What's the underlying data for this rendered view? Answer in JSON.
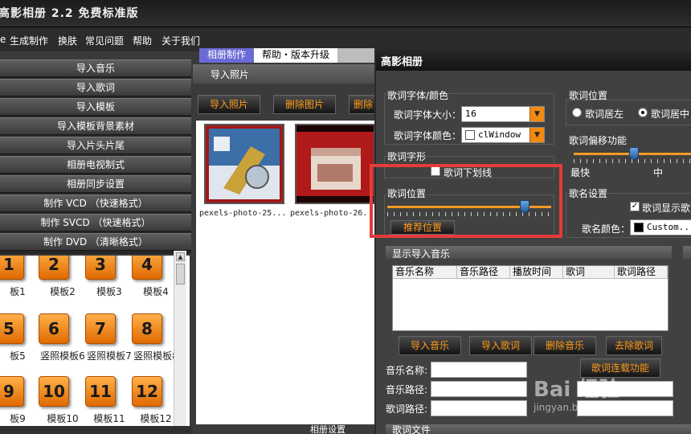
{
  "app": {
    "title": "高影相册 2.2 免费标准版"
  },
  "menubar": {
    "items": [
      "生成制作",
      "换肤",
      "常见问题",
      "帮助",
      "关于我们"
    ]
  },
  "left_menu": {
    "items": [
      "导入音乐",
      "导入歌词",
      "导入模板",
      "导入模板背景素材",
      "导入片头片尾",
      "相册电视制式",
      "相册同步设置",
      "制作 VCD （快速格式）",
      "制作 SVCD （快速格式）",
      "制作 DVD （清晰格式）"
    ]
  },
  "templates": [
    {
      "num": "1",
      "label": "板1"
    },
    {
      "num": "2",
      "label": "模板2"
    },
    {
      "num": "3",
      "label": "模板3"
    },
    {
      "num": "4",
      "label": "模板4"
    },
    {
      "num": "5",
      "label": "板5"
    },
    {
      "num": "6",
      "label": "竖照模板6"
    },
    {
      "num": "7",
      "label": "竖照模板7"
    },
    {
      "num": "8",
      "label": "竖照模板8"
    },
    {
      "num": "9",
      "label": "板9"
    },
    {
      "num": "10",
      "label": "模板10"
    },
    {
      "num": "11",
      "label": "模板11"
    },
    {
      "num": "12",
      "label": "模板12"
    }
  ],
  "center": {
    "tabs": [
      "相册制作",
      "帮助・版本升级"
    ],
    "header": "导入照片",
    "buttons": [
      "导入照片",
      "删除图片",
      "删除"
    ],
    "photos": [
      "pexels-photo-25...",
      "pexels-photo-26."
    ],
    "bottom_label": "相册设置"
  },
  "dialog": {
    "title": "高影相册",
    "font_group": {
      "label": "歌词字体/颜色",
      "size_label": "歌词字体大小：",
      "size_value": "16",
      "color_label": "歌词字体颜色：",
      "color_value": "clWindow"
    },
    "shape_group": {
      "label": "歌词字形",
      "underline_label": "歌词下划线",
      "underline_checked": false
    },
    "position_group": {
      "label": "歌词位置",
      "recommend_button": "推荐位置",
      "slider_value": 0.84
    },
    "right_position": {
      "label": "歌词位置",
      "left_option": "歌词居左",
      "center_option": "歌词居中",
      "selected": "歌词居中"
    },
    "offset_group": {
      "label": "歌词偏移功能",
      "min_label": "最快",
      "mid_label": "中",
      "slider_value": 0.5
    },
    "song_group": {
      "label": "歌名设置",
      "show_label": "歌词显示歌",
      "show_checked": true,
      "color_label": "歌名颜色：",
      "color_value": "Custom..."
    },
    "music_section": {
      "title": "显示导入音乐",
      "columns": [
        "音乐名称",
        "音乐路径",
        "播放时间",
        "歌词",
        "歌词路径"
      ],
      "buttons": [
        "导入音乐",
        "导入歌词",
        "删除音乐",
        "去除歌词"
      ],
      "extra_button": "歌词连载功能",
      "fields": [
        {
          "label": "音乐名称:",
          "value": ""
        },
        {
          "label": "音乐路径:",
          "value": ""
        },
        {
          "label": "歌词路径:",
          "value": ""
        }
      ]
    },
    "bottom_label": "歌词文件"
  },
  "watermark": {
    "big": "Bai 经验",
    "small": "jingyan.baidu.com"
  },
  "colors": {
    "accent": "#f08a12",
    "button_text": "#ff9a1a",
    "highlight": "#e53b3b",
    "slider": "#f39a24"
  }
}
